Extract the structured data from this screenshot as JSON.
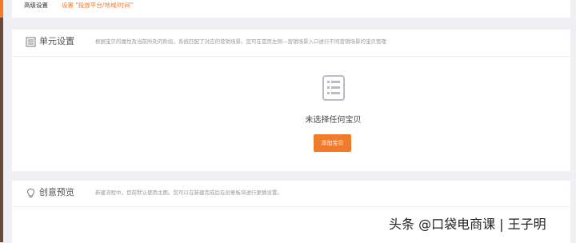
{
  "top_row": {
    "label": "高级设置",
    "link": "设置 \"投放平台/地域/时间\""
  },
  "unit_settings": {
    "title": "单元设置",
    "description": "根据宝贝的属性及当前所处的阶段，系统匹配了对应的营销场景。您可在首页左侧—营销场景入口进行不同营销场景的宝贝管理",
    "icon": "list-document-icon",
    "empty_icon": "document-list-icon",
    "empty_text": "未选择任何宝贝",
    "add_button": "添加宝贝"
  },
  "creative_preview": {
    "title": "创意预览",
    "description": "新建流程中，目前默认使用主图。您可以在新建完成后在创意板块进行更换设置。",
    "icon": "lightbulb-icon"
  },
  "watermark": "头条 @口袋电商课 | 王子明",
  "colors": {
    "accent": "#f07b2c",
    "background": "#eef0f3",
    "panel": "#ffffff"
  }
}
